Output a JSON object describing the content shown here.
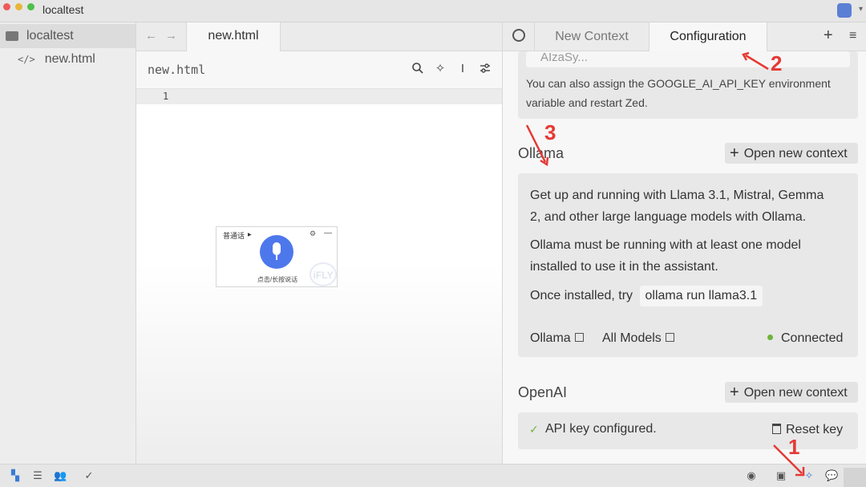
{
  "window": {
    "title": "localtest"
  },
  "sidebar": {
    "items": [
      {
        "label": "localtest",
        "icon": "folder-icon"
      },
      {
        "label": "new.html",
        "icon": "code-file-icon"
      }
    ]
  },
  "editor": {
    "tab_label": "new.html",
    "breadcrumb": "new.html",
    "line_number": "1"
  },
  "ime_widget": {
    "language": "普通话",
    "hint": "点击/长按说话",
    "brand": "iFLY"
  },
  "assistant_panel": {
    "tabs": [
      {
        "label": "New Context",
        "active": false
      },
      {
        "label": "Configuration",
        "active": true
      }
    ],
    "google": {
      "api_key_placeholder": "AIzaSy...",
      "note_line1": "You can also assign the GOOGLE_AI_API_KEY environment",
      "note_line2": "variable and restart Zed."
    },
    "ollama": {
      "title": "Ollama",
      "open_context": "Open new context",
      "desc1_line1": "Get up and running with Llama 3.1, Mistral, Gemma",
      "desc1_line2": "2, and other large language models with Ollama.",
      "desc2_line1": "Ollama must be running with at least one model",
      "desc2_line2": "installed to use it in the assistant.",
      "desc3": "Once installed, try",
      "command": "ollama run llama3.1",
      "link_ollama": "Ollama",
      "link_models": "All Models",
      "status": "Connected",
      "status_color": "#6fb43a"
    },
    "openai": {
      "title": "OpenAI",
      "open_context": "Open new context",
      "configured": "API key configured.",
      "reset": "Reset key"
    }
  },
  "annotations": {
    "n1": "1",
    "n2": "2",
    "n3": "3",
    "color": "#e53935"
  }
}
